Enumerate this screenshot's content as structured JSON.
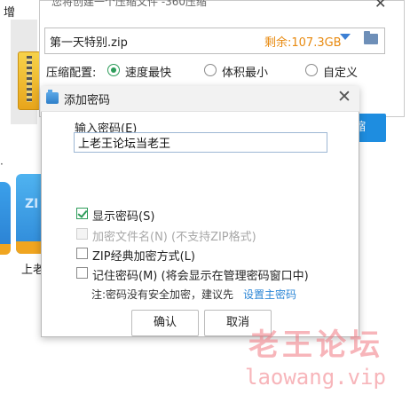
{
  "background": {
    "top_label": "增",
    "item_label": "上老",
    "thumb_text": "ZI",
    "side_glyph": "·"
  },
  "main_dialog": {
    "title": "您将创建一个压缩文件 -360压缩",
    "close_glyph": "✕",
    "file_name": "第一天特别.zip",
    "free_space": "剩余:107.3GB",
    "config_label": "压缩配置:",
    "options": [
      {
        "label": "速度最快",
        "selected": true
      },
      {
        "label": "体积最小",
        "selected": false
      },
      {
        "label": "自定义",
        "selected": false
      }
    ],
    "compress_button": "缩"
  },
  "password_dialog": {
    "title": "添加密码",
    "close_glyph": "✕",
    "prompt": "输入密码(E)",
    "password_value": "上老王论坛当老王",
    "checkboxes": [
      {
        "label": "显示密码(S)",
        "checked": true,
        "enabled": true
      },
      {
        "label": "加密文件名(N) (不支持ZIP格式)",
        "checked": false,
        "enabled": false
      },
      {
        "label": "ZIP经典加密方式(L)",
        "checked": false,
        "enabled": true
      },
      {
        "label": "记住密码(M) (将会显示在管理密码窗口中)",
        "checked": false,
        "enabled": true
      }
    ],
    "note_text": "注:密码没有安全加密，建议先",
    "note_link": "设置主密码",
    "ok_button": "确认",
    "cancel_button": "取消"
  },
  "watermark": {
    "cn": "老王论坛",
    "en": "laowang.vip"
  },
  "colors": {
    "accent_green": "#2d9c5a",
    "accent_blue": "#1e8de0",
    "free_space_orange": "#e88a10",
    "link_blue": "#2b86d6",
    "watermark_pink": "#f07882"
  }
}
